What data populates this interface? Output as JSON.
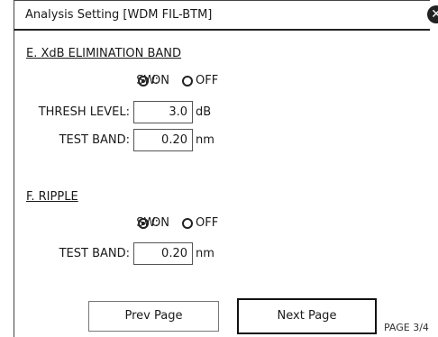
{
  "window": {
    "title": "Analysis Setting [WDM FIL-BTM]",
    "close_icon": "close-icon"
  },
  "section_e": {
    "title": "E. XdB ELIMINATION BAND",
    "sw_label": "SW:",
    "on_label": "ON",
    "off_label": "OFF",
    "sw_selected": "ON",
    "thresh_label": "THRESH LEVEL:",
    "thresh_value": "3.0",
    "thresh_unit": "dB",
    "band_label": "TEST BAND:",
    "band_value": "0.20",
    "band_unit": "nm"
  },
  "section_f": {
    "title": "F. RIPPLE",
    "sw_label": "SW:",
    "on_label": "ON",
    "off_label": "OFF",
    "sw_selected": "ON",
    "band_label": "TEST BAND:",
    "band_value": "0.20",
    "band_unit": "nm"
  },
  "footer": {
    "prev_label": "Prev Page",
    "next_label": "Next Page",
    "page_indicator": "PAGE 3/4"
  }
}
